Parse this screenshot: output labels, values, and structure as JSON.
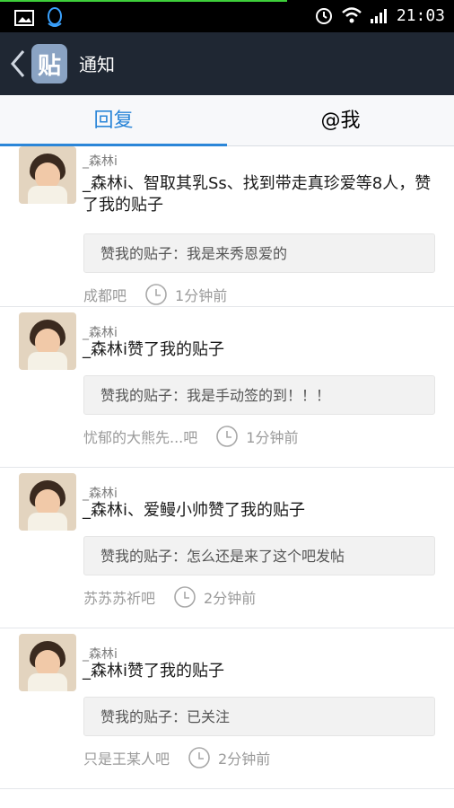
{
  "status_bar": {
    "time": "21:03"
  },
  "header": {
    "title": "通知",
    "logo_text": "贴"
  },
  "tabs": [
    {
      "label": "回复"
    },
    {
      "label": "@我"
    }
  ],
  "notifications": [
    {
      "username": "_森林i",
      "content": "_森林i、智取其乳Ss、找到带走真珍爱等8人，赞了我的贴子",
      "quote": "赞我的贴子：我是来秀恩爱的",
      "forum": "成都吧",
      "time": "1分钟前"
    },
    {
      "username": "_森林i",
      "content": "_森林i赞了我的贴子",
      "quote": "赞我的贴子：我是手动签的到！！！",
      "forum": "忧郁的大熊先...吧",
      "time": "1分钟前"
    },
    {
      "username": "_森林i",
      "content": "_森林i、爱鳗小帅赞了我的贴子",
      "quote": "赞我的贴子：怎么还是来了这个吧发帖",
      "forum": "苏苏苏祈吧",
      "time": "2分钟前"
    },
    {
      "username": "_森林i",
      "content": "_森林i赞了我的贴子",
      "quote": "赞我的贴子：已关注",
      "forum": "只是王某人吧",
      "time": "2分钟前"
    }
  ]
}
